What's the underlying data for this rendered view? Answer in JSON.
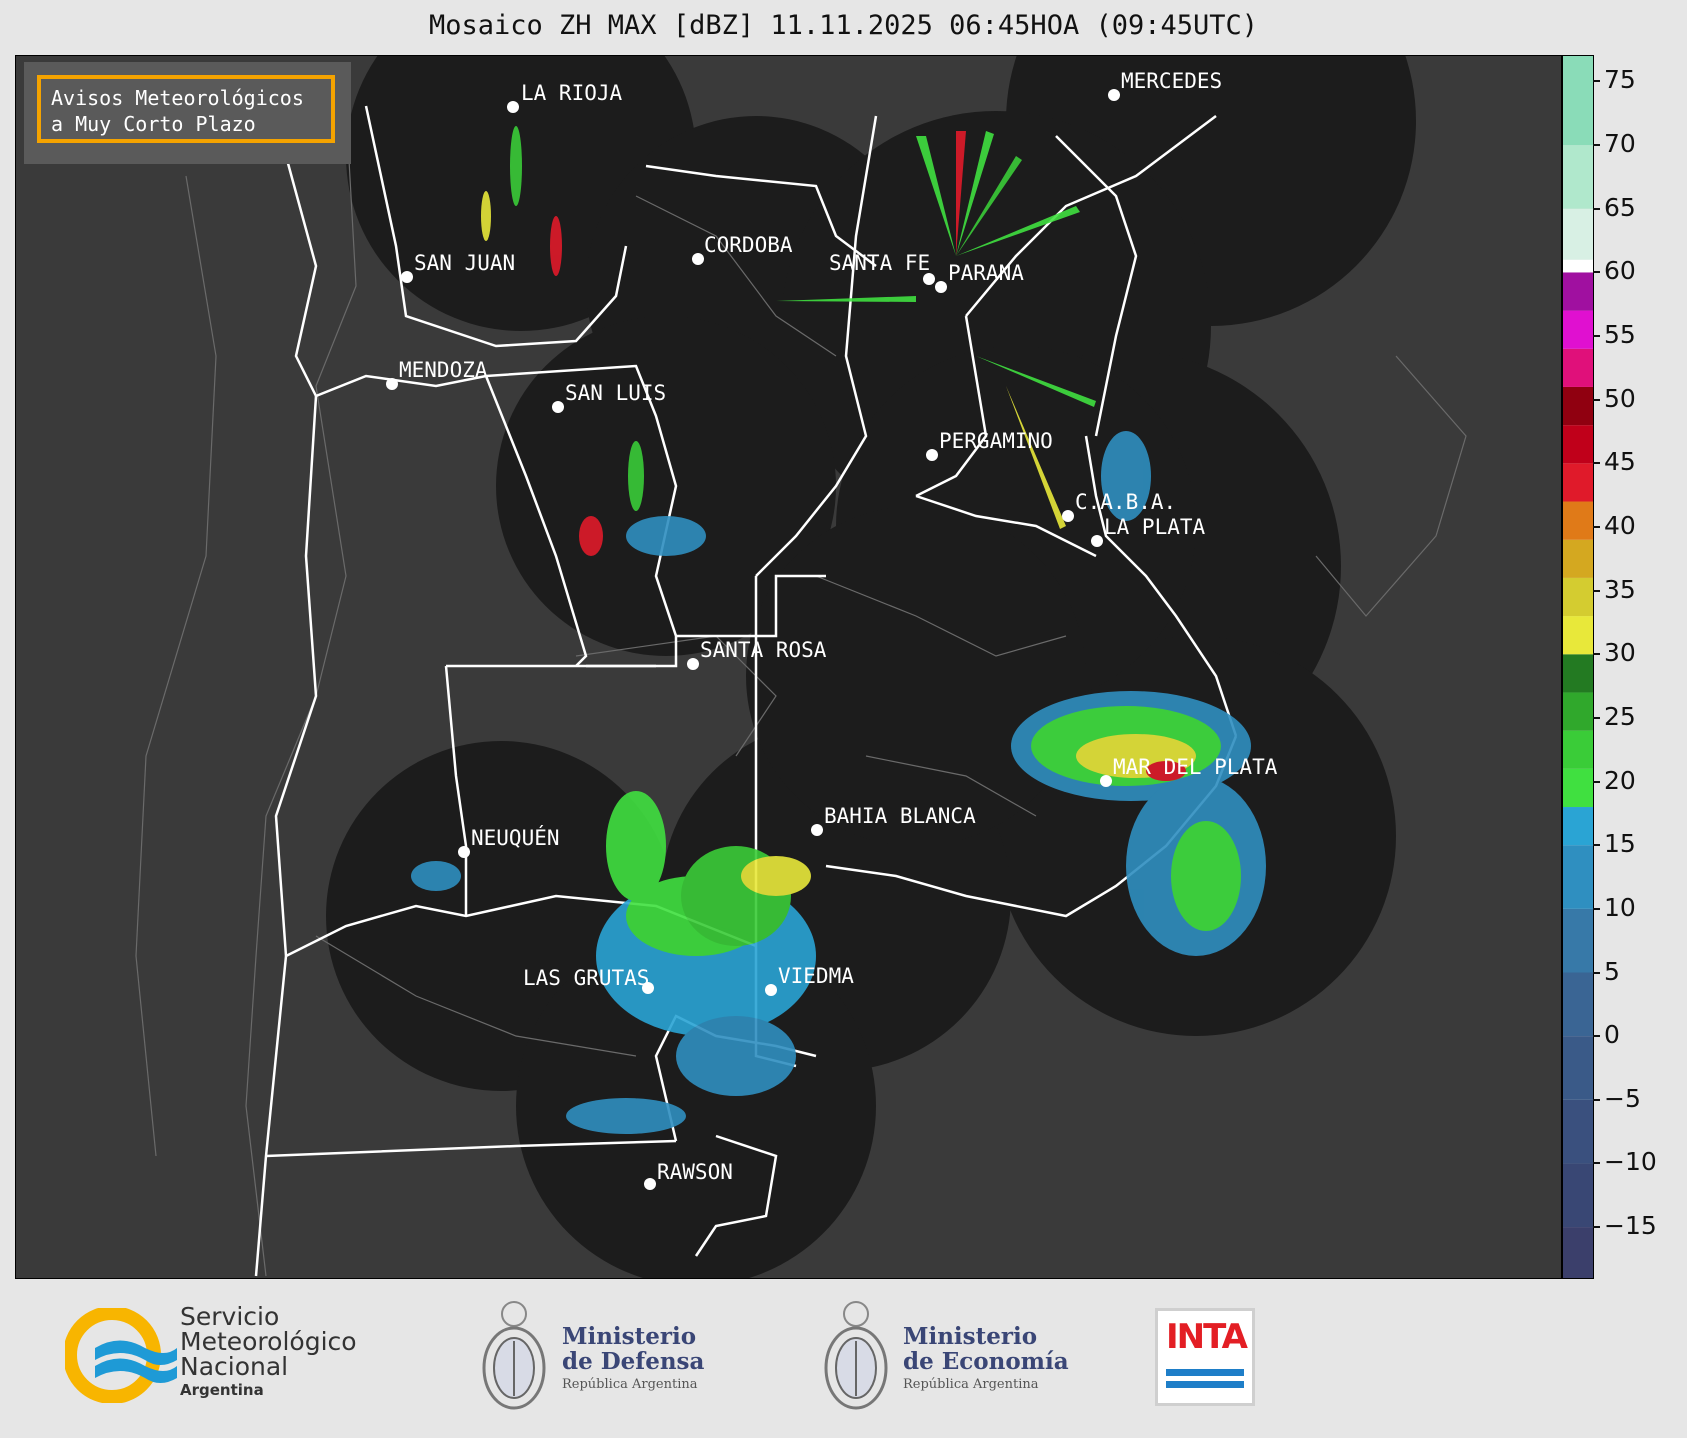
{
  "title": "Mosaico ZH MAX [dBZ] 11.11.2025 06:45HOA (09:45UTC)",
  "notice": {
    "line1": "Avisos Meteorológicos",
    "line2": "a Muy Corto Plazo"
  },
  "cities": [
    {
      "name": "LA RIOJA"
    },
    {
      "name": "MERCEDES"
    },
    {
      "name": "CORDOBA"
    },
    {
      "name": "SAN JUAN"
    },
    {
      "name": "SANTA FE"
    },
    {
      "name": "PARANA"
    },
    {
      "name": "MENDOZA"
    },
    {
      "name": "SAN LUIS"
    },
    {
      "name": "PERGAMINO"
    },
    {
      "name": "C.A.B.A."
    },
    {
      "name": "LA PLATA"
    },
    {
      "name": "SANTA ROSA"
    },
    {
      "name": "MAR DEL PLATA"
    },
    {
      "name": "BAHIA BLANCA"
    },
    {
      "name": "NEUQUÉN"
    },
    {
      "name": "LAS GRUTAS"
    },
    {
      "name": "VIEDMA"
    },
    {
      "name": "RAWSON"
    }
  ],
  "colorbar": {
    "min": -19,
    "max": 77,
    "ticks": [
      "75",
      "70",
      "65",
      "60",
      "55",
      "50",
      "45",
      "40",
      "35",
      "30",
      "25",
      "20",
      "15",
      "10",
      "5",
      "0",
      "−5",
      "−10",
      "−15"
    ],
    "tick_values": [
      75,
      70,
      65,
      60,
      55,
      50,
      45,
      40,
      35,
      30,
      25,
      20,
      15,
      10,
      5,
      0,
      -5,
      -10,
      -15
    ],
    "colors": [
      {
        "from": -19,
        "to": -15,
        "color": "#3b3f6b"
      },
      {
        "from": -15,
        "to": -10,
        "color": "#394774"
      },
      {
        "from": -10,
        "to": -5,
        "color": "#3a507e"
      },
      {
        "from": -5,
        "to": 0,
        "color": "#3a5a88"
      },
      {
        "from": 0,
        "to": 5,
        "color": "#3a6594"
      },
      {
        "from": 5,
        "to": 10,
        "color": "#3779a8"
      },
      {
        "from": 10,
        "to": 15,
        "color": "#2f8fc0"
      },
      {
        "from": 15,
        "to": 18,
        "color": "#2aa4d4"
      },
      {
        "from": 18,
        "to": 21,
        "color": "#40e040"
      },
      {
        "from": 21,
        "to": 24,
        "color": "#3acc38"
      },
      {
        "from": 24,
        "to": 27,
        "color": "#30a82c"
      },
      {
        "from": 27,
        "to": 30,
        "color": "#237a22"
      },
      {
        "from": 30,
        "to": 33,
        "color": "#e8e83a"
      },
      {
        "from": 33,
        "to": 36,
        "color": "#d4cc30"
      },
      {
        "from": 36,
        "to": 39,
        "color": "#d4a820"
      },
      {
        "from": 39,
        "to": 42,
        "color": "#e07a18"
      },
      {
        "from": 42,
        "to": 45,
        "color": "#e01a2a"
      },
      {
        "from": 45,
        "to": 48,
        "color": "#c0001a"
      },
      {
        "from": 48,
        "to": 51,
        "color": "#900010"
      },
      {
        "from": 51,
        "to": 54,
        "color": "#e0107a"
      },
      {
        "from": 54,
        "to": 57,
        "color": "#e010d0"
      },
      {
        "from": 57,
        "to": 60,
        "color": "#a010a0"
      },
      {
        "from": 60,
        "to": 61,
        "color": "#ffffff"
      },
      {
        "from": 61,
        "to": 65,
        "color": "#d8f0e4"
      },
      {
        "from": 65,
        "to": 70,
        "color": "#b0e8cc"
      },
      {
        "from": 70,
        "to": 77,
        "color": "#8adcb8"
      }
    ]
  },
  "logos": {
    "smn": {
      "line1": "Servicio",
      "line2": "Meteorológico",
      "line3": "Nacional",
      "line4": "Argentina"
    },
    "defensa": {
      "line1": "Ministerio",
      "line2": "de Defensa",
      "line3": "República Argentina"
    },
    "economia": {
      "line1": "Ministerio",
      "line2": "de Economía",
      "line3": "República Argentina"
    },
    "inta": {
      "label": "INTA"
    }
  }
}
